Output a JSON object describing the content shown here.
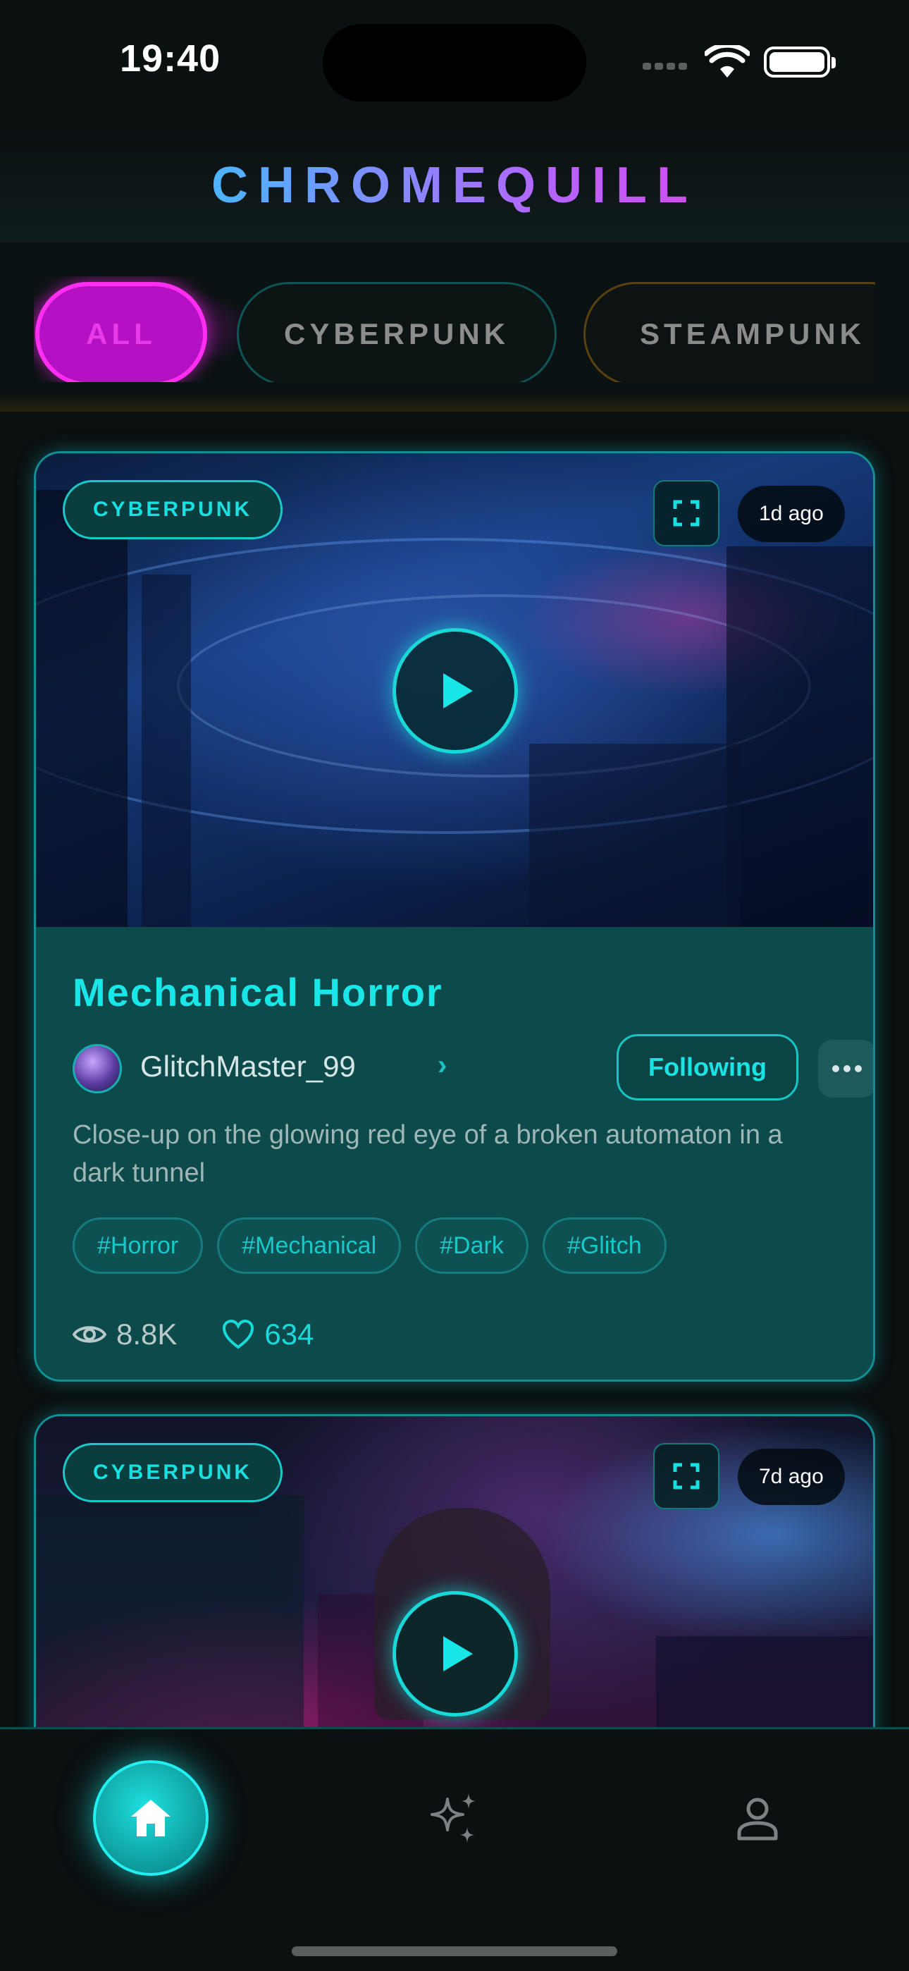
{
  "status_bar": {
    "time": "19:40",
    "wifi_icon": "wifi-icon",
    "battery_icon": "battery-icon"
  },
  "header": {
    "brand": "CHROMEQUILL"
  },
  "filters": [
    {
      "label": "ALL",
      "selected": true
    },
    {
      "label": "CYBERPUNK",
      "selected": false
    },
    {
      "label": "STEAMPUNK",
      "selected": false
    }
  ],
  "posts": [
    {
      "category": "CYBERPUNK",
      "age": "1d ago",
      "title": "Mechanical Horror",
      "author": "GlitchMaster_99",
      "follow_label": "Following",
      "description": "Close-up on the glowing red eye of a broken automaton in a dark tunnel",
      "hashtags": [
        "#Horror",
        "#Mechanical",
        "#Dark",
        "#Glitch"
      ],
      "views": "8.8K",
      "likes": "634"
    },
    {
      "category": "CYBERPUNK",
      "age": "7d ago"
    }
  ],
  "nav": {
    "items": [
      {
        "name": "home",
        "icon": "home-icon",
        "active": true
      },
      {
        "name": "create",
        "icon": "sparkles-icon",
        "active": false
      },
      {
        "name": "profile",
        "icon": "person-icon",
        "active": false
      }
    ]
  },
  "colors": {
    "accent": "#19e0e0",
    "chip_selected": "#b410c4",
    "background": "#0b1011",
    "card": "#0c4a4b"
  }
}
